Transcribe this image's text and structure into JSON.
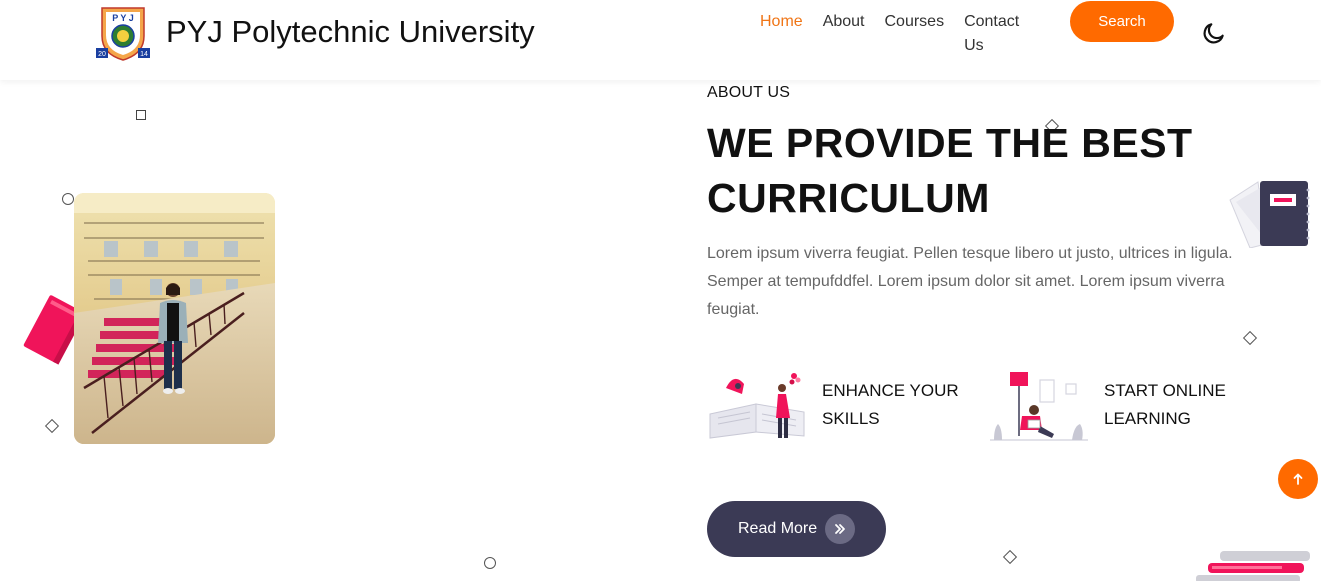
{
  "header": {
    "brand_name": "PYJ Polytechnic University",
    "logo_text_top": "P Y J",
    "logo_year_left": "20",
    "logo_year_right": "14",
    "nav": [
      {
        "label": "Home",
        "active": true
      },
      {
        "label": "About"
      },
      {
        "label": "Courses"
      },
      {
        "label": "Contact Us"
      }
    ],
    "search_label": "Search",
    "theme_icon": "moon-icon"
  },
  "about": {
    "eyebrow": "ABOUT US",
    "headline": "WE PROVIDE THE BEST CURRICULUM",
    "description": "Lorem ipsum viverra feugiat. Pellen tesque libero ut justo, ultrices in ligula. Semper at tempufddfel. Lorem ipsum dolor sit amet. Lorem ipsum viverra feugiat.",
    "features": [
      {
        "label": "ENHANCE YOUR SKILLS",
        "icon": "reading-book-illustration"
      },
      {
        "label": "START ONLINE LEARNING",
        "icon": "online-learning-illustration"
      }
    ],
    "read_more_label": "Read More",
    "read_more_icon": "double-chevron-right-icon"
  },
  "scroll_top_icon": "arrow-up-icon",
  "colors": {
    "accent": "#ff6a00",
    "nav_active": "#f07516",
    "button_dark": "#3b3a55",
    "pink": "#f0145a"
  }
}
